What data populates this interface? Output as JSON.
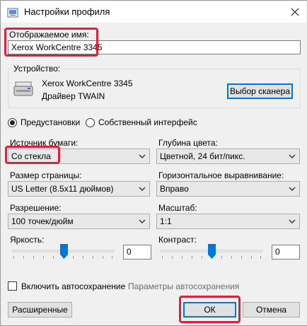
{
  "window": {
    "title": "Настройки профиля"
  },
  "profile": {
    "label": "Отображаемое имя:",
    "value": "Xerox WorkCentre 3345"
  },
  "device": {
    "group_label": "Устройство:",
    "name": "Xerox WorkCentre 3345",
    "driver": "Драйвер TWAIN",
    "select_button": "Выбор сканера"
  },
  "mode": {
    "option_presets": "Предустановки",
    "option_custom": "Собственный интерфейс",
    "selected": "presets"
  },
  "fields": {
    "paper_source": {
      "label": "Источник бумаги:",
      "value": "Со стекла"
    },
    "color_depth": {
      "label": "Глубина цвета:",
      "value": "Цветной, 24 бит/пикс."
    },
    "page_size": {
      "label": "Размер страницы:",
      "value": "US Letter (8.5x11 дюймов)"
    },
    "h_align": {
      "label": "Горизонтальное выравнивание:",
      "value": "Вправо"
    },
    "resolution": {
      "label": "Разрешение:",
      "value": "100 точек/дюйм"
    },
    "scale": {
      "label": "Масштаб:",
      "value": "1:1"
    }
  },
  "brightness": {
    "label": "Яркость:",
    "value": "0"
  },
  "contrast": {
    "label": "Контраст:",
    "value": "0"
  },
  "autosave": {
    "checkbox_label": "Включить автосохранение",
    "settings_link": "Параметры автосохранения"
  },
  "buttons": {
    "advanced": "Расширенные",
    "ok": "ОК",
    "cancel": "Отмена"
  },
  "colors": {
    "highlight": "#e0203a",
    "slider_thumb": "#0078d7"
  }
}
